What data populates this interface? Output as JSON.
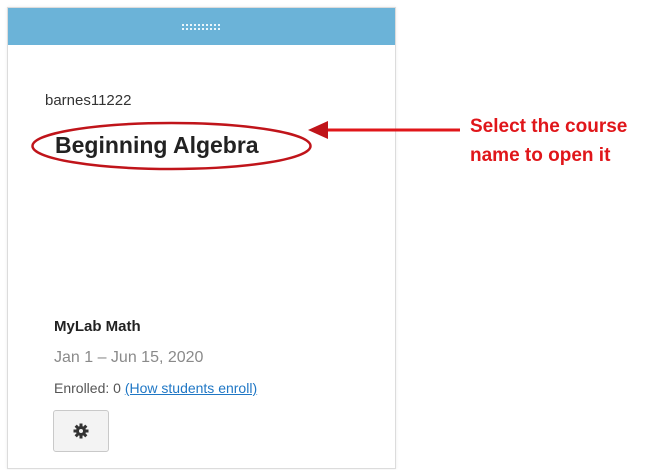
{
  "card": {
    "course_id": "barnes11222",
    "course_title": "Beginning Algebra",
    "product": "MyLab Math",
    "dates": "Jan 1 – Jun 15, 2020",
    "enrolled_label": "Enrolled: 0",
    "enroll_link": "(How students enroll)",
    "settings_icon": "gear-icon",
    "drag_handle_icon": "drag-grip-icon"
  },
  "annotation": {
    "line1": "Select the course",
    "line2": "name to open it",
    "color": "#e0161a"
  },
  "colors": {
    "header_bar": "#6bb3d8",
    "link": "#1f77c5"
  }
}
